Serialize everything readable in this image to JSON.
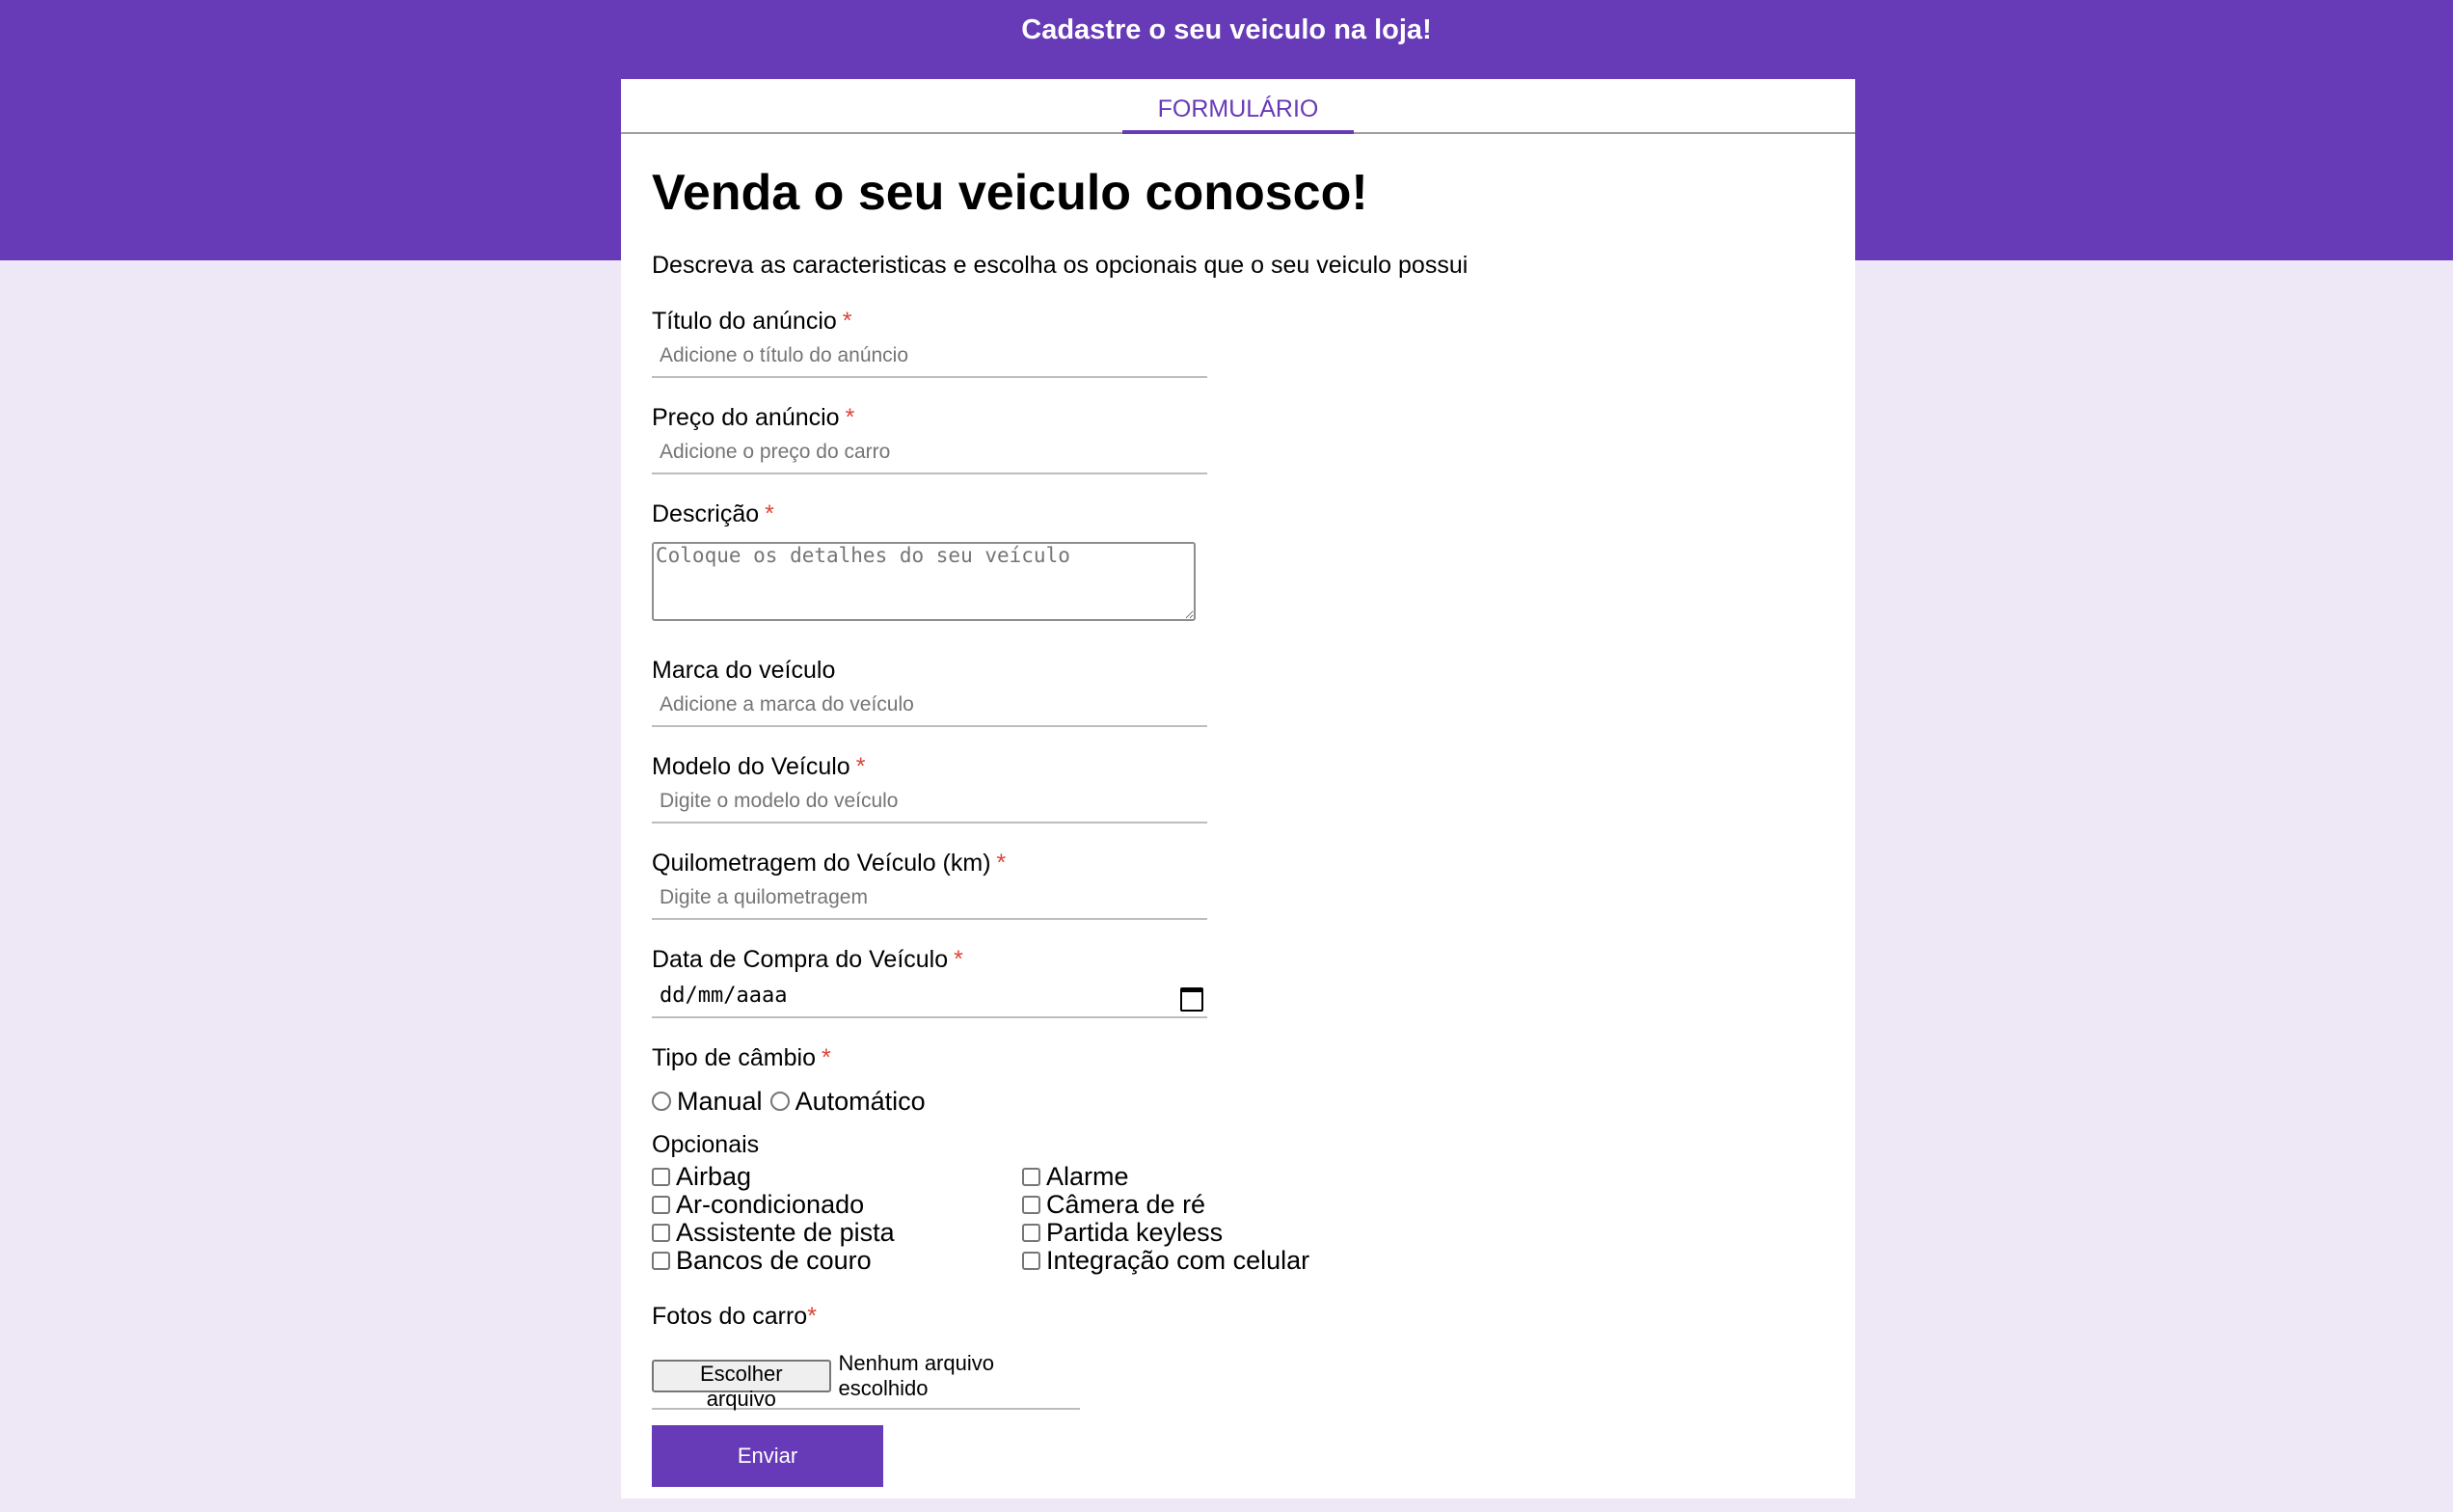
{
  "header": {
    "title": "Cadastre o seu veiculo na loja!"
  },
  "tabs": [
    {
      "label": "FORMULÁRIO",
      "active": true
    }
  ],
  "form": {
    "heading": "Venda o seu veiculo conosco!",
    "subtitle": "Descreva as caracteristicas e escolha os opcionais que o seu veiculo possui",
    "required_mark": "*",
    "titulo": {
      "label": "Título do anúncio",
      "placeholder": "Adicione o título do anúncio",
      "value": ""
    },
    "preco": {
      "label": "Preço do anúncio",
      "placeholder": "Adicione o preço do carro",
      "value": ""
    },
    "descricao": {
      "label": "Descrição",
      "placeholder": "Coloque os detalhes do seu veículo",
      "value": ""
    },
    "marca": {
      "label": "Marca do veículo",
      "placeholder": "Adicione a marca do veículo",
      "value": ""
    },
    "modelo": {
      "label": "Modelo do Veículo",
      "placeholder": "Digite o modelo do veículo",
      "value": ""
    },
    "quilometragem": {
      "label": "Quilometragem do Veículo (km)",
      "placeholder": "Digite a quilometragem",
      "value": ""
    },
    "data_compra": {
      "label": "Data de Compra do Veículo",
      "display": "dd/mm/aaaa"
    },
    "cambio": {
      "label": "Tipo de câmbio",
      "options": [
        "Manual",
        "Automático"
      ]
    },
    "opcionais": {
      "label": "Opcionais",
      "items": [
        "Airbag",
        "Alarme",
        "Ar-condicionado",
        "Câmera de ré",
        "Assistente de pista",
        "Partida keyless",
        "Bancos de couro",
        "Integração com celular"
      ]
    },
    "fotos": {
      "label": "Fotos do carro",
      "button_label": "Escolher arquivo",
      "status": "Nenhum arquivo escolhido"
    },
    "submit_label": "Enviar"
  },
  "colors": {
    "accent": "#673ab7",
    "background": "#ede7f6",
    "required": "#db4437"
  }
}
